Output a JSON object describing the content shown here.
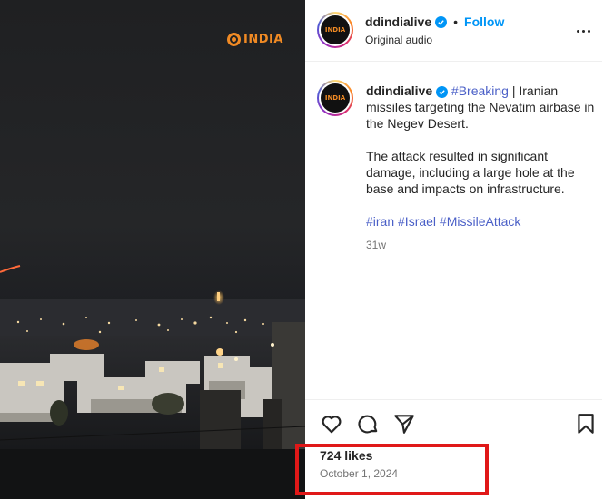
{
  "media": {
    "watermark_text": "INDIA",
    "watermark_color": "#f08a24"
  },
  "header": {
    "username": "ddindialive",
    "avatar_text": "INDIA",
    "separator": "•",
    "follow_label": "Follow",
    "audio_label": "Original audio"
  },
  "caption": {
    "username": "ddindialive",
    "hashtag_breaking": "#Breaking",
    "text_1": " | Iranian missiles targeting the Nevatim airbase in the Negev Desert.",
    "text_2": "The attack resulted in significant damage, including a large hole at the base and impacts on infrastructure.",
    "hashtags": "#iran #Israel #MissileAttack",
    "age": "31w"
  },
  "footer": {
    "likes": "724 likes",
    "date": "October 1, 2024"
  },
  "colors": {
    "link": "#0095f6",
    "hashtag": "#4a5fc7",
    "highlight": "#e01818"
  },
  "icons": [
    "heart-icon",
    "comment-icon",
    "share-icon",
    "bookmark-icon",
    "more-options-icon",
    "verified-icon"
  ]
}
